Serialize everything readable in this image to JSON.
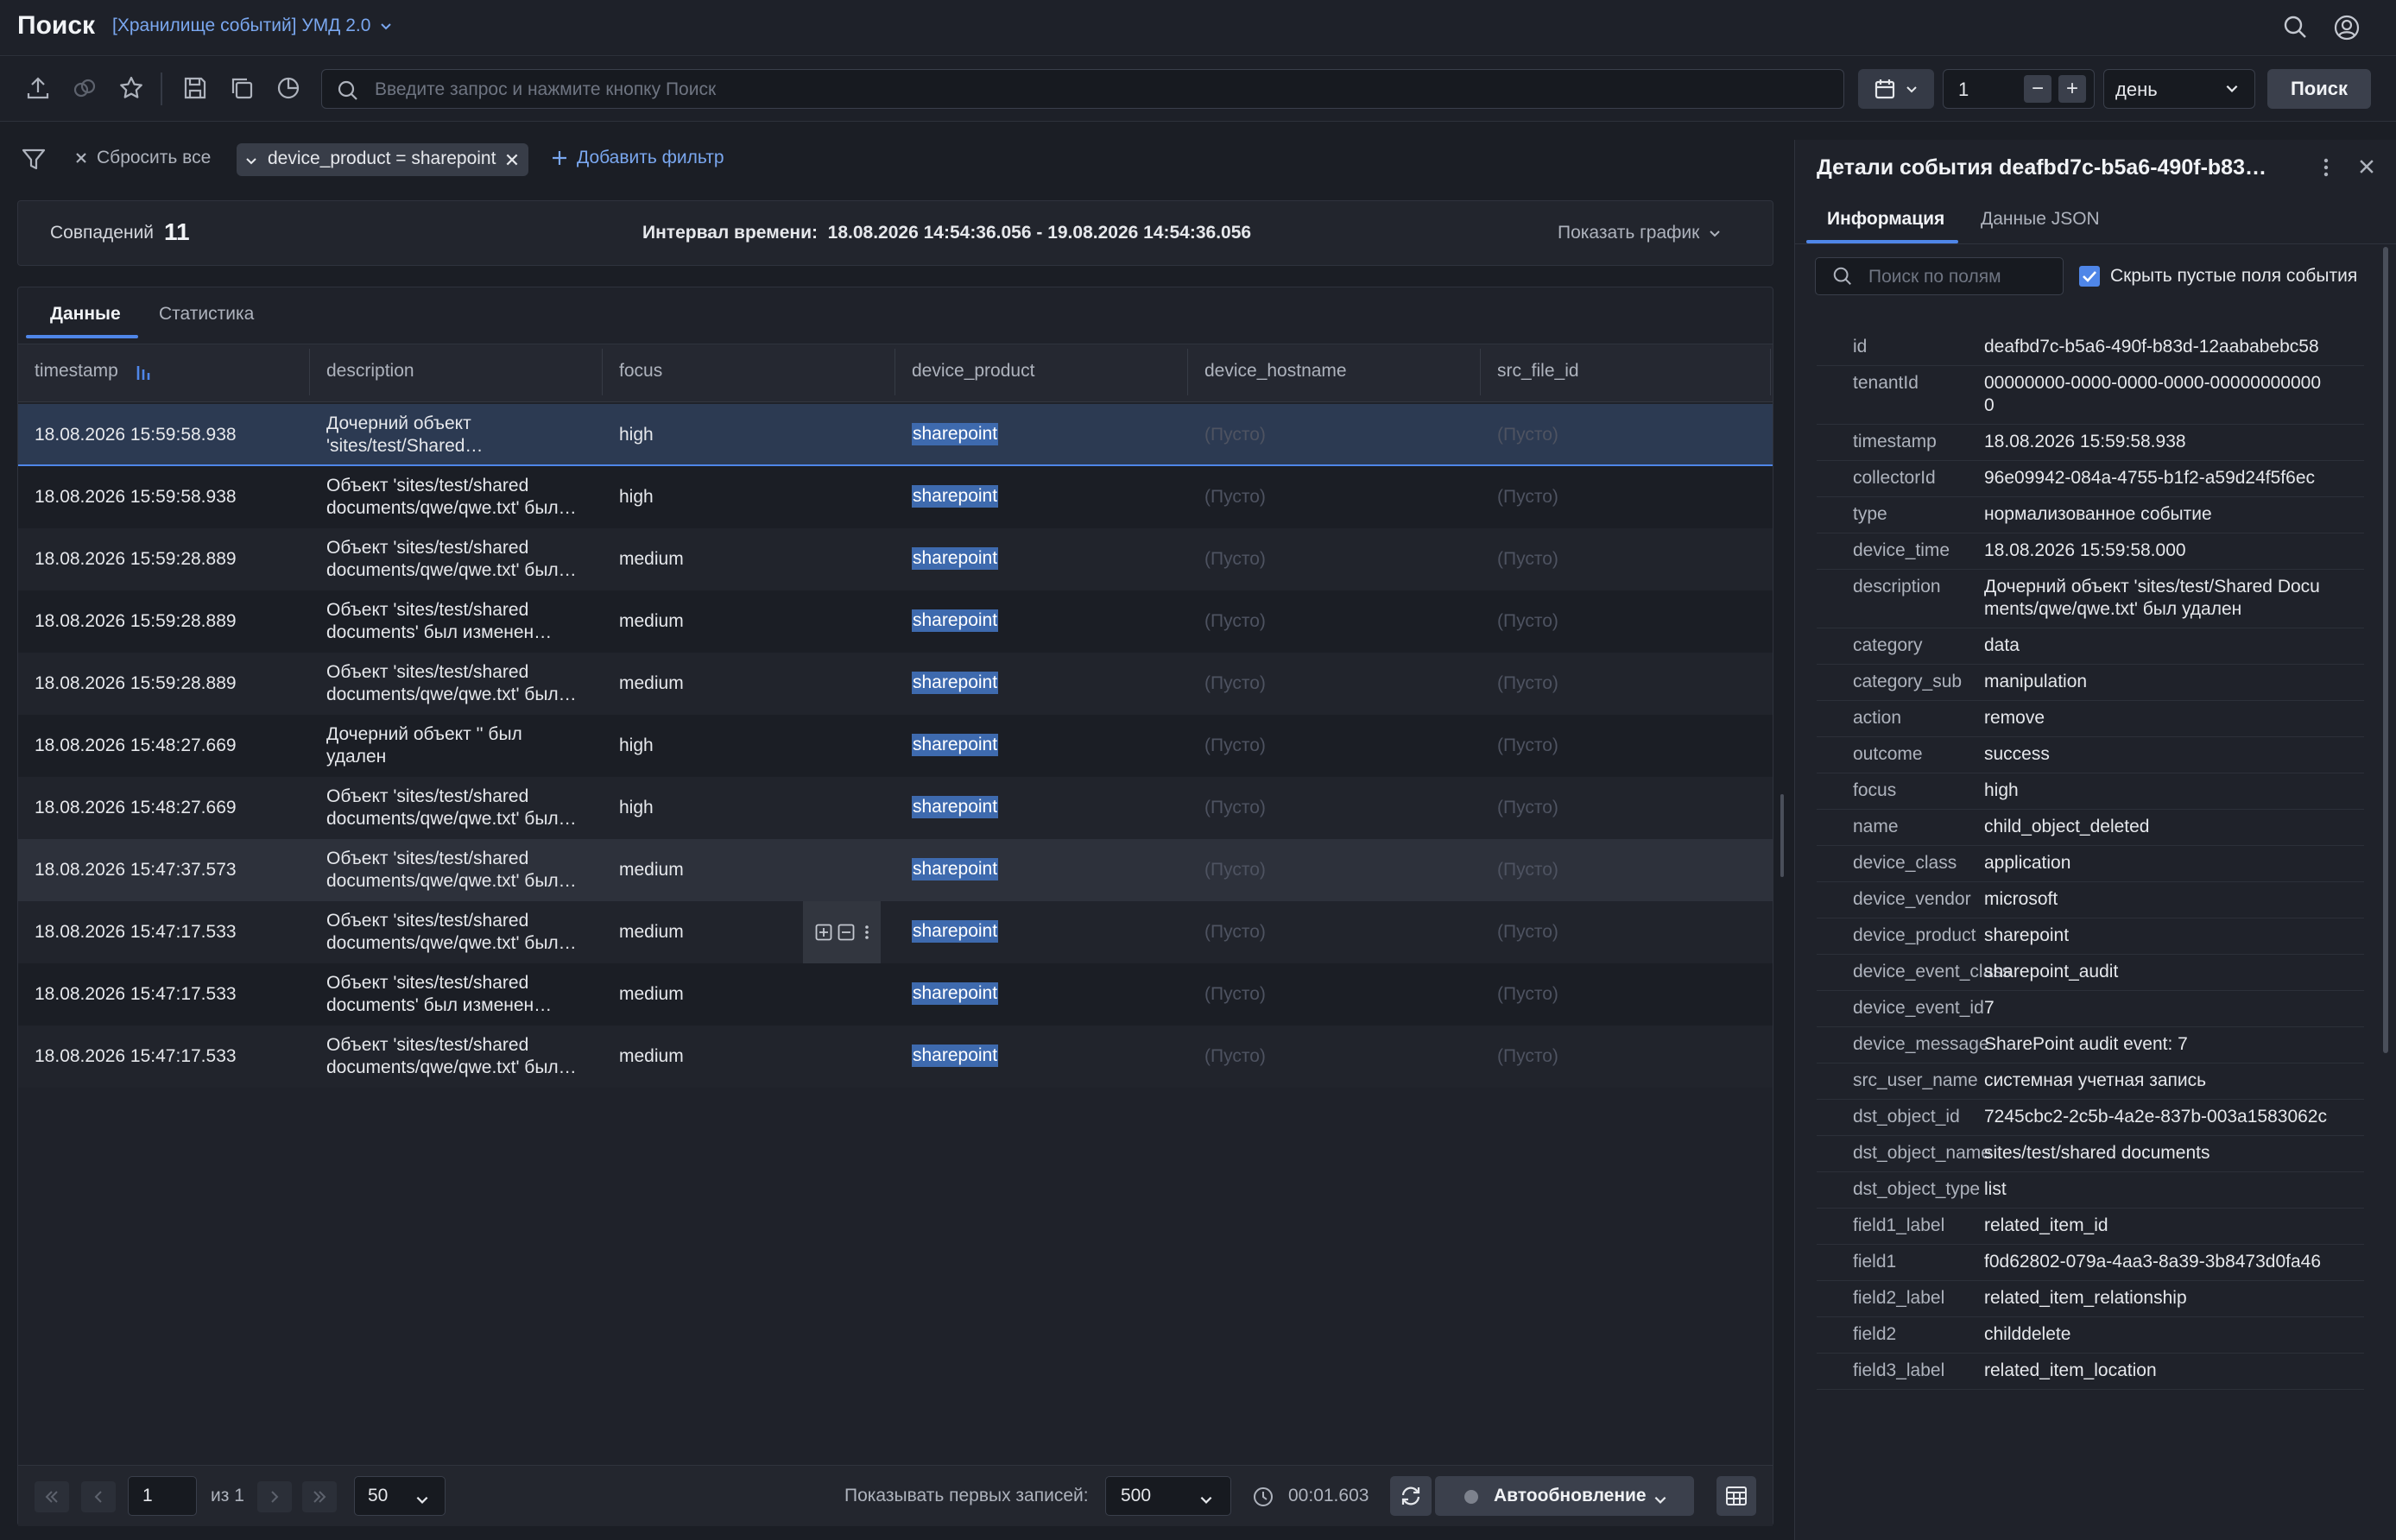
{
  "header": {
    "title": "Поиск",
    "storage": "[Хранилище событий] УМД 2.0"
  },
  "toolbar": {
    "query_placeholder": "Введите запрос и нажмите кнопку Поиск",
    "period_count": "1",
    "period_unit": "день",
    "search_label": "Поиск"
  },
  "filters": {
    "reset_all": "Сбросить все",
    "chip": "device_product = sharepoint",
    "add_filter": "Добавить фильтр"
  },
  "summary": {
    "matches_label": "Совпадений",
    "matches": "11",
    "interval": "Интервал времени:  18.08.2026 14:54:36.056 - 19.08.2026 14:54:36.056",
    "show_chart": "Показать график"
  },
  "tabs": [
    "Данные",
    "Статистика"
  ],
  "table": {
    "columns": [
      "timestamp",
      "description",
      "focus",
      "device_product",
      "device_hostname",
      "src_file_id"
    ],
    "rows": [
      {
        "ts": "18.08.2026 15:59:58.938",
        "d1": "Дочерний объект",
        "d2": "'sites/test/Shared…",
        "focus": "high",
        "product": "sharepoint",
        "host": "(Пусто)",
        "src": "(Пусто)"
      },
      {
        "ts": "18.08.2026 15:59:58.938",
        "d1": "Объект 'sites/test/shared",
        "d2": "documents/qwe/qwe.txt' был…",
        "focus": "high",
        "product": "sharepoint",
        "host": "(Пусто)",
        "src": "(Пусто)"
      },
      {
        "ts": "18.08.2026 15:59:28.889",
        "d1": "Объект 'sites/test/shared",
        "d2": "documents/qwe/qwe.txt' был…",
        "focus": "medium",
        "product": "sharepoint",
        "host": "(Пусто)",
        "src": "(Пусто)"
      },
      {
        "ts": "18.08.2026 15:59:28.889",
        "d1": "Объект 'sites/test/shared",
        "d2": "documents' был изменен…",
        "focus": "medium",
        "product": "sharepoint",
        "host": "(Пусто)",
        "src": "(Пусто)"
      },
      {
        "ts": "18.08.2026 15:59:28.889",
        "d1": "Объект 'sites/test/shared",
        "d2": "documents/qwe/qwe.txt' был…",
        "focus": "medium",
        "product": "sharepoint",
        "host": "(Пусто)",
        "src": "(Пусто)"
      },
      {
        "ts": "18.08.2026 15:48:27.669",
        "d1": "Дочерний объект '' был",
        "d2": "удален",
        "focus": "high",
        "product": "sharepoint",
        "host": "(Пусто)",
        "src": "(Пусто)"
      },
      {
        "ts": "18.08.2026 15:48:27.669",
        "d1": "Объект 'sites/test/shared",
        "d2": "documents/qwe/qwe.txt' был…",
        "focus": "high",
        "product": "sharepoint",
        "host": "(Пусто)",
        "src": "(Пусто)"
      },
      {
        "ts": "18.08.2026 15:47:37.573",
        "d1": "Объект 'sites/test/shared",
        "d2": "documents/qwe/qwe.txt' был…",
        "focus": "medium",
        "product": "sharepoint",
        "host": "(Пусто)",
        "src": "(Пусто)"
      },
      {
        "ts": "18.08.2026 15:47:17.533",
        "d1": "Объект 'sites/test/shared",
        "d2": "documents/qwe/qwe.txt' был…",
        "focus": "medium",
        "product": "sharepoint",
        "host": "(Пусто)",
        "src": "(Пусто)"
      },
      {
        "ts": "18.08.2026 15:47:17.533",
        "d1": "Объект 'sites/test/shared",
        "d2": "documents' был изменен…",
        "focus": "medium",
        "product": "sharepoint",
        "host": "(Пусто)",
        "src": "(Пусто)"
      },
      {
        "ts": "18.08.2026 15:47:17.533",
        "d1": "Объект 'sites/test/shared",
        "d2": "documents/qwe/qwe.txt' был…",
        "focus": "medium",
        "product": "sharepoint",
        "host": "(Пусто)",
        "src": "(Пусто)"
      }
    ]
  },
  "pagination": {
    "page": "1",
    "of": "из 1",
    "page_size": "50",
    "first_label": "Показывать первых записей:",
    "first_value": "500",
    "elapsed": "00:01.603",
    "autorefresh": "Автообновление"
  },
  "detail": {
    "title": "Детали события deafbd7c-b5a6-490f-b83d-12...",
    "tabs": [
      "Информация",
      "Данные JSON"
    ],
    "search_placeholder": "Поиск по полям",
    "hide_empty": "Скрыть пустые поля события",
    "fields": [
      {
        "k": "id",
        "v": "deafbd7c-b5a6-490f-b83d-12aababebc58"
      },
      {
        "k": "tenantId",
        "v": "00000000-0000-0000-0000-000000000000"
      },
      {
        "k": "timestamp",
        "v": "18.08.2026 15:59:58.938"
      },
      {
        "k": "collectorId",
        "v": "96e09942-084a-4755-b1f2-a59d24f5f6ec"
      },
      {
        "k": "type",
        "v": "нормализованное событие"
      },
      {
        "k": "device_time",
        "v": "18.08.2026 15:59:58.000"
      },
      {
        "k": "description",
        "v": "Дочерний объект 'sites/test/Shared Documents/qwe/qwe.txt' был удален"
      },
      {
        "k": "category",
        "v": "data"
      },
      {
        "k": "category_sub",
        "v": "manipulation"
      },
      {
        "k": "action",
        "v": "remove"
      },
      {
        "k": "outcome",
        "v": "success"
      },
      {
        "k": "focus",
        "v": "high"
      },
      {
        "k": "name",
        "v": "child_object_deleted"
      },
      {
        "k": "device_class",
        "v": "application"
      },
      {
        "k": "device_vendor",
        "v": "microsoft"
      },
      {
        "k": "device_product",
        "v": "sharepoint"
      },
      {
        "k": "device_event_class",
        "v": "sharepoint_audit"
      },
      {
        "k": "device_event_id",
        "v": "7"
      },
      {
        "k": "device_message",
        "v": "SharePoint audit event: 7"
      },
      {
        "k": "src_user_name",
        "v": "системная учетная запись"
      },
      {
        "k": "dst_object_id",
        "v": "7245cbc2-2c5b-4a2e-837b-003a1583062c"
      },
      {
        "k": "dst_object_name",
        "v": "sites/test/shared documents"
      },
      {
        "k": "dst_object_type",
        "v": "list"
      },
      {
        "k": "field1_label",
        "v": "related_item_id"
      },
      {
        "k": "field1",
        "v": "f0d62802-079a-4aa3-8a39-3b8473d0fa46"
      },
      {
        "k": "field2_label",
        "v": "related_item_relationship"
      },
      {
        "k": "field2",
        "v": "childdelete"
      },
      {
        "k": "field3_label",
        "v": "related_item_location"
      }
    ]
  },
  "icons": {
    "header": [
      "search-icon",
      "user-icon"
    ],
    "toolbar": [
      "upload-icon",
      "link-icon",
      "star-icon",
      "save-icon",
      "copy-icon",
      "pie-chart-icon",
      "calendar-icon"
    ]
  },
  "colors": {
    "accent": "#4f86e8",
    "link": "#7aa7ef",
    "highlight": "#3e6aae",
    "background": "#1b1e25"
  }
}
